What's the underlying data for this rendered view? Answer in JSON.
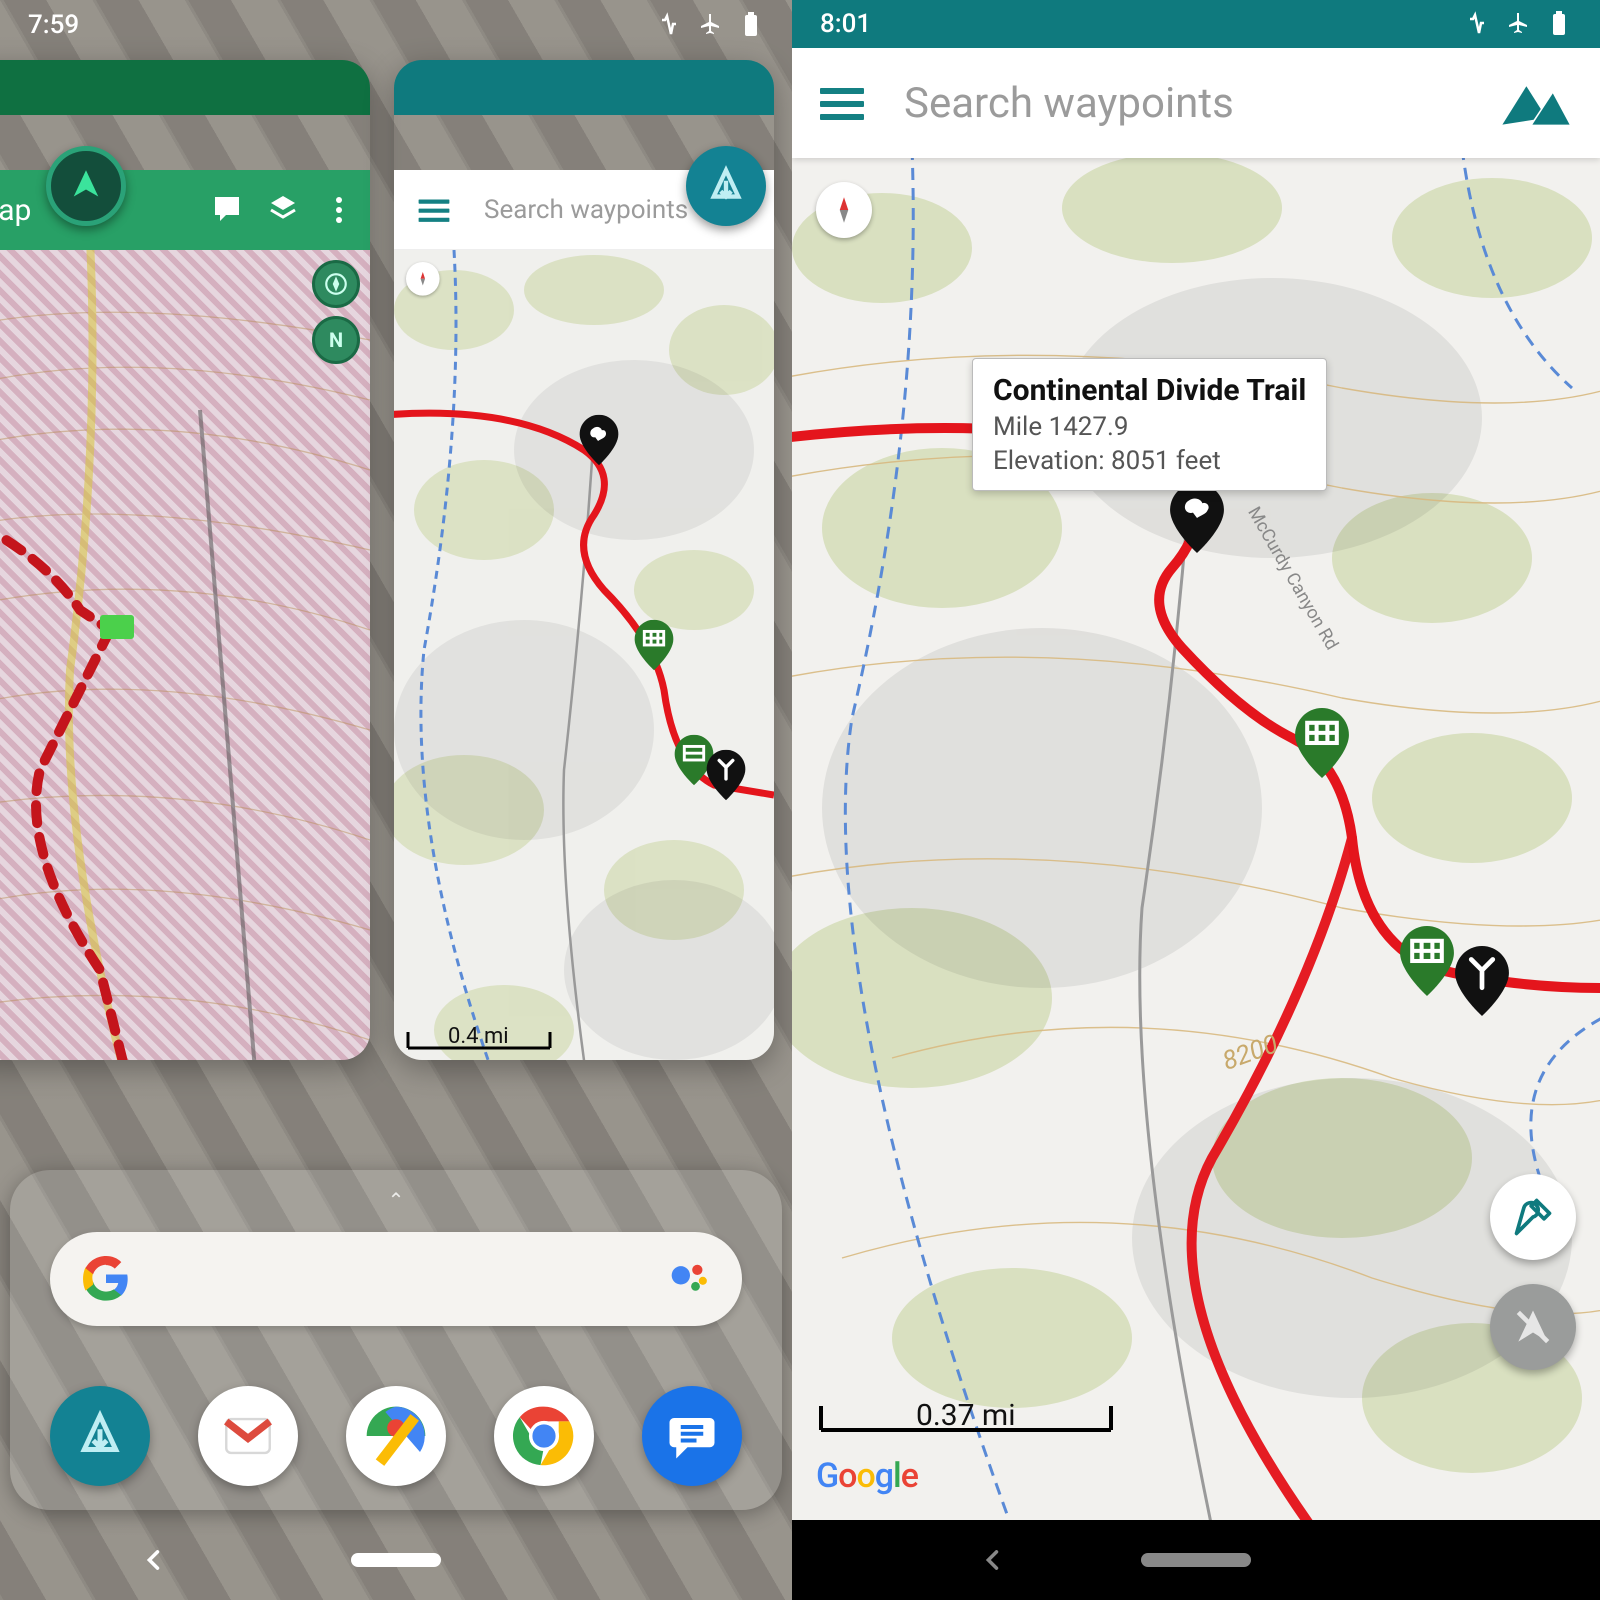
{
  "left": {
    "status_time": "7:59",
    "card1": {
      "title": "Map"
    },
    "card2": {
      "search_placeholder": "Search waypoints",
      "scale": "0.4 mi"
    },
    "home": {
      "search_hint": "",
      "dock_items": [
        "trail-app",
        "gmail",
        "maps",
        "chrome",
        "messages"
      ]
    }
  },
  "right": {
    "status_time": "8:01",
    "search_placeholder": "Search waypoints",
    "tooltip": {
      "title": "Continental Divide Trail",
      "mile_label": "Mile 1427.9",
      "elevation_label": "Elevation: 8051 feet"
    },
    "scale": "0.37 mi",
    "contour_label": "8200",
    "road_label": "McCurdy Canyon Rd"
  },
  "colors": {
    "teal": "#138293",
    "green": "#28a066",
    "marker_green": "#2a7a2a",
    "marker_black": "#111"
  }
}
